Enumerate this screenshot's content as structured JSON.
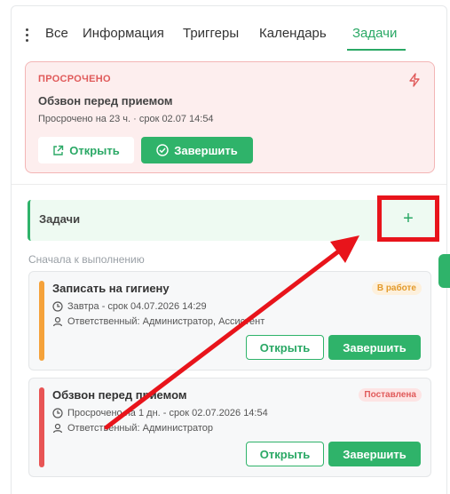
{
  "tabs": [
    "Все",
    "Информация",
    "Триггеры",
    "Календарь",
    "Задачи"
  ],
  "active_tab": "Задачи",
  "overdue": {
    "badge": "ПРОСРОЧЕНО",
    "title": "Обзвон перед приемом",
    "meta": "Просрочено на 23 ч. · срок 02.07 14:54",
    "open_label": "Открыть",
    "complete_label": "Завершить"
  },
  "tasks_section": {
    "title": "Задачи",
    "add_label": "+",
    "sort_label": "Сначала к выполнению"
  },
  "tasks": [
    {
      "title": "Записать на гигиену",
      "due": "Завтра - срок 04.07.2026 14:29",
      "responsible": "Ответственный: Администратор, Ассистент",
      "status": "В работе",
      "status_color": "#e39a2b",
      "status_bg": "#fdf0dc",
      "bar_color": "#f5a23a",
      "open_label": "Открыть",
      "complete_label": "Завершить"
    },
    {
      "title": "Обзвон перед приемом",
      "due": "Просрочено на 1 дн. - срок 02.07.2026 14:54",
      "responsible": "Ответственный: Администратор",
      "status": "Поставлена",
      "status_color": "#e05a5a",
      "status_bg": "#fde4e4",
      "bar_color": "#e85555",
      "open_label": "Открыть",
      "complete_label": "Завершить"
    }
  ],
  "colors": {
    "accent": "#2fb36a",
    "annotation": "#e8141b"
  }
}
